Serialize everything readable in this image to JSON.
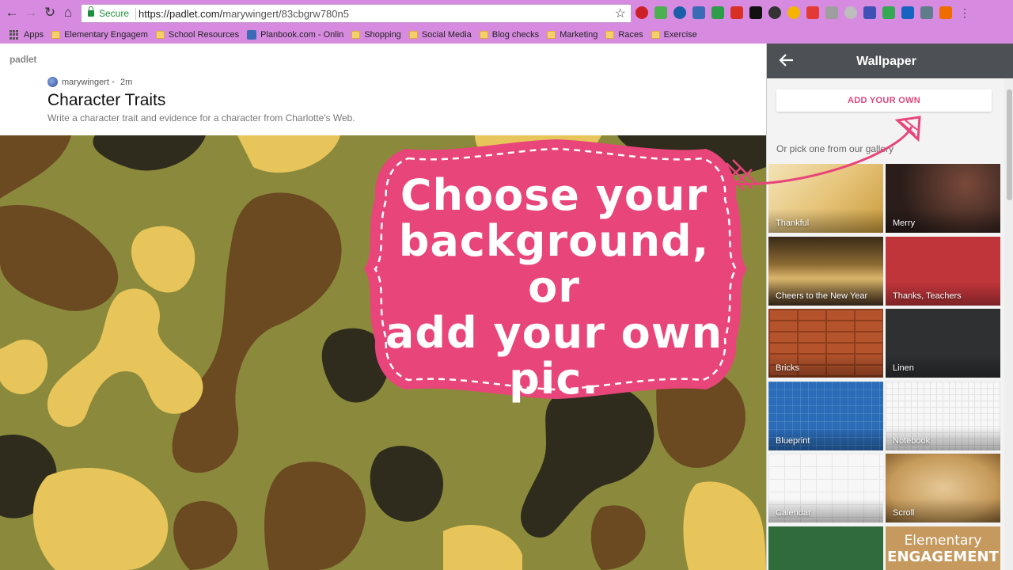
{
  "browser": {
    "secure_label": "Secure",
    "url_host": "https://padlet.com/",
    "url_path": "marywingert/83cbgrw780n5",
    "bookmarks": [
      {
        "label": "Apps"
      },
      {
        "label": "Elementary Engagem"
      },
      {
        "label": "School Resources"
      },
      {
        "label": "Planbook.com - Onlin"
      },
      {
        "label": "Shopping"
      },
      {
        "label": "Social Media"
      },
      {
        "label": "Blog checks"
      },
      {
        "label": "Marketing"
      },
      {
        "label": "Races"
      },
      {
        "label": "Exercise"
      }
    ]
  },
  "padlet": {
    "logo": "padlet",
    "author": "marywingert",
    "age": "2m",
    "title": "Character Traits",
    "description": "Write a character trait and evidence for a character from Charlotte's Web."
  },
  "callout": {
    "text_line1": "Choose your",
    "text_line2": "background, or",
    "text_line3": "add your own",
    "text_line4": "pic."
  },
  "panel": {
    "title": "Wallpaper",
    "add_own_label": "ADD YOUR OWN",
    "gallery_label": "Or pick one from our gallery",
    "tiles": [
      {
        "label": "Thankful"
      },
      {
        "label": "Merry"
      },
      {
        "label": "Cheers to the New Year"
      },
      {
        "label": "Thanks, Teachers"
      },
      {
        "label": "Bricks"
      },
      {
        "label": "Linen"
      },
      {
        "label": "Blueprint"
      },
      {
        "label": "Notebook"
      },
      {
        "label": "Calendar"
      },
      {
        "label": "Scroll"
      },
      {
        "label": ""
      },
      {
        "label": "Elementary",
        "label2": "ENGAGEMENT"
      }
    ]
  },
  "colors": {
    "chrome": "#d78be0",
    "callout_pink": "#e8457a",
    "panel_header": "#4d5054",
    "accent": "#e0467d"
  }
}
